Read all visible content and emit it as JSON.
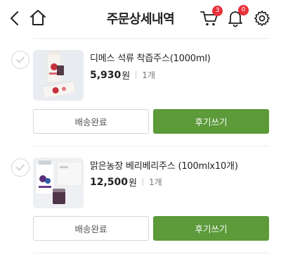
{
  "header": {
    "title": "주문상세내역",
    "cart_count": "3",
    "notification_count": "0",
    "badge_color": "#e8303a"
  },
  "orders": [
    {
      "product_name": "디메스 석류 착즙주스(1000ml)",
      "price": "5,930",
      "currency": "원",
      "quantity": "1개",
      "shipping_status_label": "배송완료",
      "review_label": "후기쓰기"
    },
    {
      "product_name": "맑은농장 베리베리주스 (100mlx10개)",
      "price": "12,500",
      "currency": "원",
      "quantity": "1개",
      "shipping_status_label": "배송완료",
      "review_label": "후기쓰기"
    }
  ],
  "colors": {
    "accent_green": "#5c9a3a",
    "text": "#222222",
    "muted": "#777777"
  }
}
